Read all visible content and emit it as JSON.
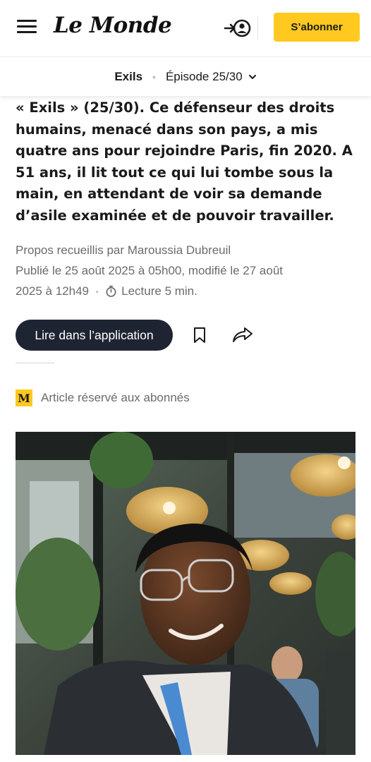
{
  "header": {
    "logo": "Le Monde",
    "subscribe_label": "S’abonner",
    "icons": {
      "menu": "hamburger-menu-icon",
      "account": "account-login-icon"
    }
  },
  "subnav": {
    "series": "Exils",
    "separator": "•",
    "episode": "Épisode 25/30",
    "chevron": "chevron-down-icon"
  },
  "article": {
    "chapo": "« Exils » (25/30). Ce défenseur des droits humains, menacé dans son pays, a mis quatre ans pour rejoindre Paris, fin 2020. A 51 ans, il lit tout ce qui lui tombe sous la main, en attendant de voir sa demande d’asile examinée et de pouvoir travailler.",
    "byline": "Propos recueillis par Maroussia Dubreuil",
    "published_line1": "Publié le 25 août 2025 à 05h00, modifié le 27 août",
    "published_line2": "2025 à 12h49",
    "meta_separator": "·",
    "reading_time": "Lecture 5 min.",
    "open_app_label": "Lire dans l’application",
    "premium_badge": "M",
    "premium_label": "Article réservé aux abonnés"
  },
  "colors": {
    "brand_yellow": "#ffc91f",
    "app_button": "#1f2433",
    "meta_text": "#6b6b6b",
    "text": "#1a1a1a"
  }
}
